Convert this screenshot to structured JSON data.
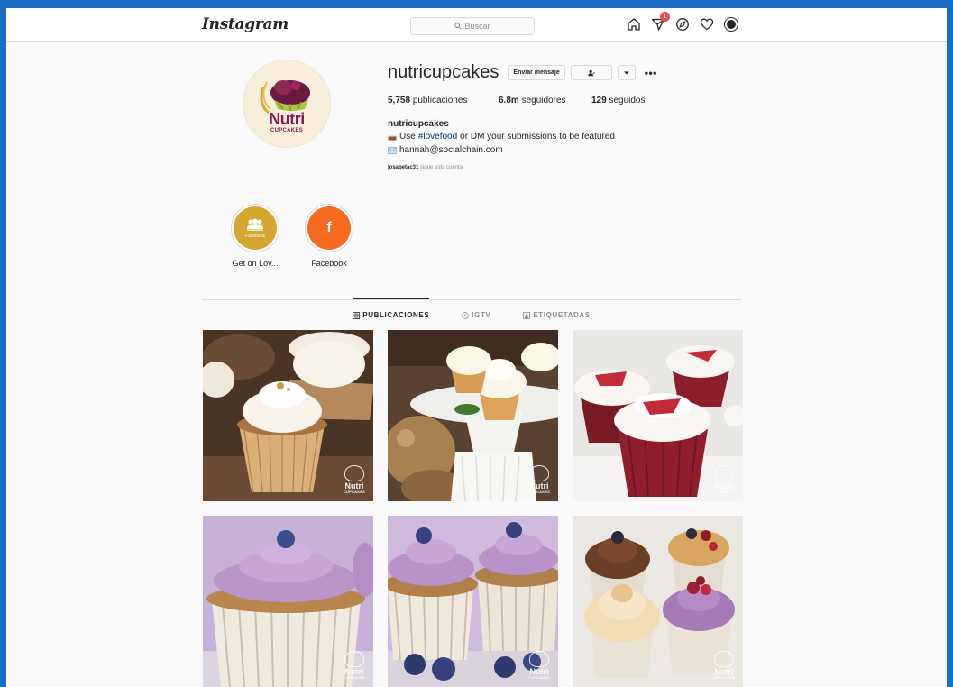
{
  "topnav": {
    "logo": "Instagram",
    "search_placeholder": "Buscar",
    "icons": [
      "home-icon",
      "direct-icon",
      "explore-icon",
      "activity-icon",
      "profile-avatar"
    ],
    "direct_badge": "1"
  },
  "profile": {
    "username": "nutricupcakes",
    "avatar": {
      "line1": "Nutri",
      "line2": "CUPCAKES"
    },
    "message_button": "Enviar mensaje",
    "more_icon": "•••",
    "stats": {
      "posts_count": "5,758",
      "posts_label": "publicaciones",
      "followers_count": "6.8m",
      "followers_label": "seguidores",
      "following_count": "129",
      "following_label": "seguidos"
    },
    "bio": {
      "name": "nutricupcakes",
      "line1_prefix": "Use ",
      "line1_hashtag": "#lovefood",
      "line1_suffix": " or DM your submissions to be featured",
      "line2": "hannah@socialchain.com"
    },
    "followed_by": {
      "user": "josabetac31",
      "text": " sigue esta cuenta"
    }
  },
  "highlights": [
    {
      "label": "Get on Lov...",
      "inner_text": "Facebook",
      "color": "#d6a730"
    },
    {
      "label": "Facebook",
      "inner_text": "f",
      "color": "#f56a1f"
    }
  ],
  "tabs": [
    {
      "label": "PUBLICACIONES",
      "active": true
    },
    {
      "label": "IGTV",
      "active": false
    },
    {
      "label": "ETIQUETADAS",
      "active": false
    }
  ],
  "watermark": {
    "text": "Nutri",
    "sub": "CUPCAKES"
  },
  "colors": {
    "accent_link": "#00376b",
    "badge": "#ed4956",
    "brand": "#8a1a54",
    "frame": "#1a6fc4"
  }
}
